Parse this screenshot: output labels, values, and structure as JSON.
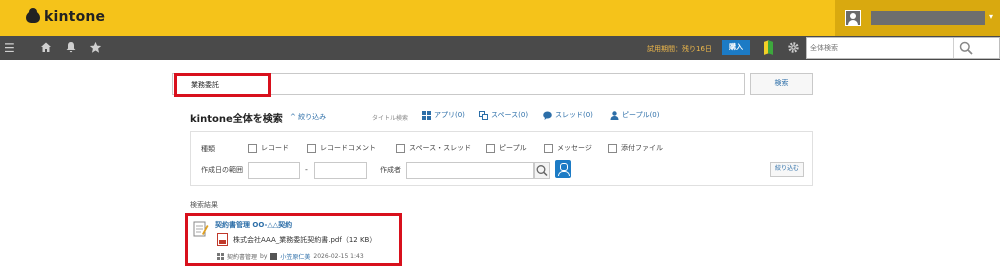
{
  "header": {
    "logo_text": "kintone",
    "brand_color": "#f5c31a"
  },
  "navbar": {
    "trial_text": "試用期間：残り16日",
    "buy_label": "購入",
    "global_search_placeholder": "全体検索",
    "icons": [
      "menu-icon",
      "home-icon",
      "bell-icon",
      "star-icon",
      "beginner-mark-icon",
      "gear-icon",
      "help-icon",
      "search-icon"
    ]
  },
  "search": {
    "query": "業務委託",
    "button_label": "検索"
  },
  "heading": {
    "title": "kintone全体を検索",
    "narrow_link": "絞り込み",
    "title_only": "タイトル検索",
    "categories": [
      {
        "label": "アプリ(0)",
        "icon": "app-icon"
      },
      {
        "label": "スペース(0)",
        "icon": "space-icon"
      },
      {
        "label": "スレッド(0)",
        "icon": "thread-icon"
      },
      {
        "label": "ピープル(0)",
        "icon": "people-icon"
      }
    ]
  },
  "filters": {
    "type_label": "種類",
    "types": [
      "レコード",
      "レコードコメント",
      "スペース・スレッド",
      "ピープル",
      "メッセージ",
      "添付ファイル"
    ],
    "date_label": "作成日の範囲",
    "date_sep": "-",
    "creator_label": "作成者",
    "narrow_button": "絞り込む"
  },
  "results": {
    "label": "検索結果",
    "items": [
      {
        "title": "契約書管理 OO-△△契約",
        "file": "株式会社AAA_業務委託契約書.pdf（12 KB）",
        "app": "契約書管理",
        "by": "by",
        "user": "小笠原仁美",
        "date": "2026-02-15 1:43"
      }
    ]
  }
}
